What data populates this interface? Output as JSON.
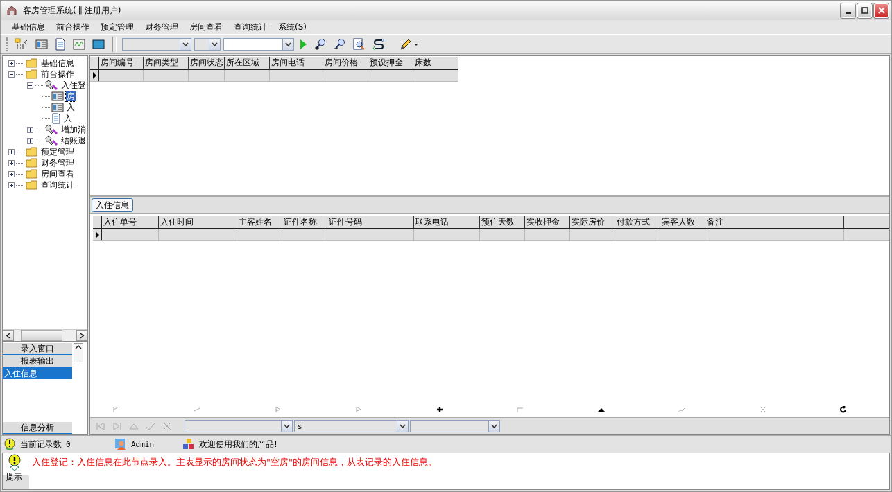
{
  "window": {
    "title": "客房管理系统(非注册用户)"
  },
  "menu": [
    {
      "label": "基础信息"
    },
    {
      "label": "前台操作"
    },
    {
      "label": "预定管理"
    },
    {
      "label": "财务管理"
    },
    {
      "label": "房间查看"
    },
    {
      "label": "查询统计"
    },
    {
      "label": "系统(S)"
    }
  ],
  "tree": [
    {
      "label": "基础信息",
      "kind": "folder",
      "expanded": false,
      "selected": false
    },
    {
      "label": "前台操作",
      "kind": "folder",
      "expanded": true,
      "selected": false,
      "children": [
        {
          "label": "入住登",
          "kind": "tool",
          "expanded": true,
          "selected": false,
          "children": [
            {
              "label": "房",
              "kind": "grid",
              "selected": true
            },
            {
              "label": "入",
              "kind": "grid",
              "selected": false
            },
            {
              "label": "入",
              "kind": "doc",
              "selected": false
            }
          ]
        },
        {
          "label": "增加消",
          "kind": "tool",
          "expanded": false,
          "selected": false
        },
        {
          "label": "结账退",
          "kind": "tool",
          "expanded": false,
          "selected": false
        }
      ]
    },
    {
      "label": "预定管理",
      "kind": "folder",
      "expanded": false,
      "selected": false
    },
    {
      "label": "财务管理",
      "kind": "folder",
      "expanded": false,
      "selected": false
    },
    {
      "label": "房间查看",
      "kind": "folder",
      "expanded": false,
      "selected": false
    },
    {
      "label": "查询统计",
      "kind": "folder",
      "expanded": false,
      "selected": false
    }
  ],
  "sidebar": {
    "sections": [
      {
        "label": "录入窗口"
      },
      {
        "label": "报表输出"
      }
    ],
    "items": [
      {
        "label": "入住信息",
        "selected": true
      }
    ],
    "bottom_section": {
      "label": "信息分析"
    }
  },
  "master_table": {
    "columns": [
      "房间编号",
      "房间类型",
      "房间状态",
      "所在区域",
      "房间电话",
      "房间价格",
      "预设押金",
      "床数"
    ]
  },
  "detail_tabs": [
    {
      "label": "入住信息",
      "selected": true
    }
  ],
  "detail_table": {
    "columns": [
      "入住单号",
      "入住时间",
      "主客姓名",
      "证件名称",
      "证件号码",
      "联系电话",
      "预住天数",
      "实收押金",
      "实际房价",
      "付款方式",
      "宾客人数",
      "备注"
    ]
  },
  "navigator": {
    "filters": [
      {
        "kind": "blank"
      },
      {
        "kind": "text",
        "value": "s"
      },
      {
        "kind": "blank"
      }
    ]
  },
  "status_bar": [
    {
      "kind": "records",
      "label": "当前记录数",
      "value": "0"
    },
    {
      "kind": "user",
      "label": "Admin"
    },
    {
      "kind": "message",
      "label": "欢迎使用我们的产品!"
    }
  ],
  "hint": {
    "text": "入住登记：入住信息在此节点录入。主表显示的房间状态为\"空房\"的房间信息，从表记录的入住信息。",
    "label": "提示"
  }
}
